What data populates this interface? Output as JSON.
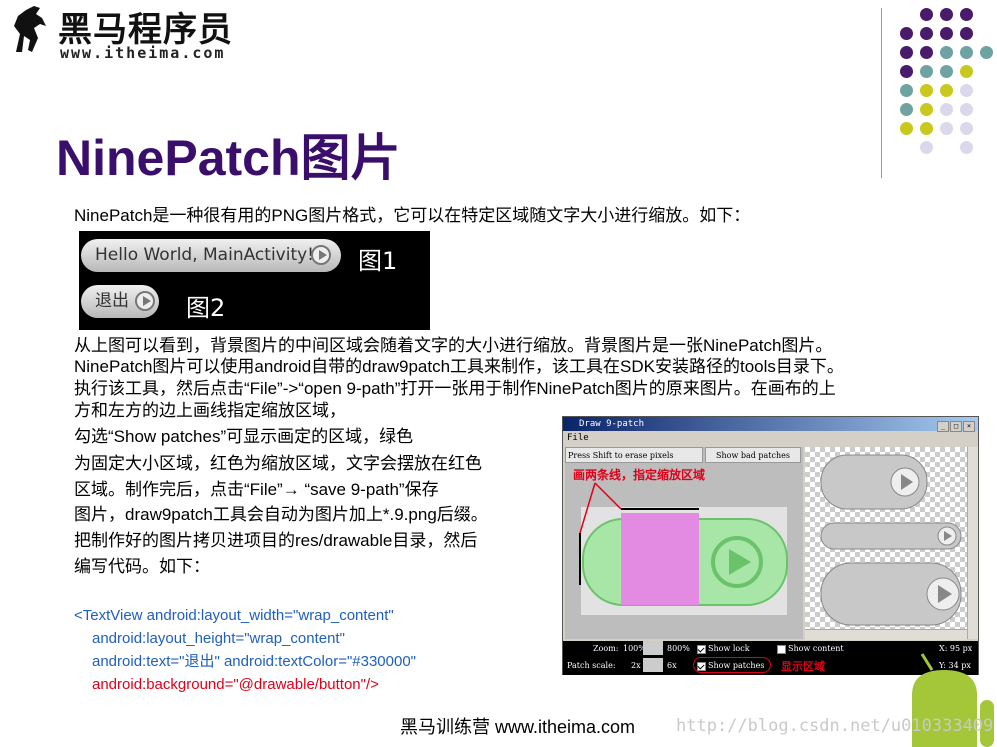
{
  "logo": {
    "brand": "黑马程序员",
    "url": "www.itheima.com"
  },
  "title": "NinePatch图片",
  "intro": "NinePatch是一种很有用的PNG图片格式，它可以在特定区域随文字大小进行缩放。如下：",
  "demo": {
    "button1": "Hello World, MainActivity!",
    "fig1": "图1",
    "button2": "退出",
    "fig2": "图2"
  },
  "paragraph": [
    "从上图可以看到，背景图片的中间区域会随着文字的大小进行缩放。背景图片是一张NinePatch图片。",
    "NinePatch图片可以使用android自带的draw9patch工具来制作，该工具在SDK安装路径的tools目录下。",
    "执行该工具，然后点击“File”->“open 9-path”打开一张用于制作NinePatch图片的原来图片。在画布的上",
    "方和左方的边上画线指定缩放区域，",
    "勾选“Show patches”可显示画定的区域，绿色",
    "为固定大小区域，红色为缩放区域，文字会摆放在红色",
    "区域。制作完后，点击“File”→ “save 9-path”保存",
    "图片，draw9patch工具会自动为图片加上*.9.png后缀。",
    "把制作好的图片拷贝进项目的res/drawable目录，然后",
    "编写代码。如下："
  ],
  "code": [
    "<TextView android:layout_width=\"wrap_content\"",
    "android:layout_height=\"wrap_content\"",
    "android:text=\"退出\" android:textColor=\"#330000\"",
    "android:background=\"@drawable/button\"/>"
  ],
  "window": {
    "title": "Draw 9-patch",
    "menu": "File",
    "hint": "Press Shift to erase pixels",
    "bad_patches": "Show bad patches",
    "annotation_top": "画两条线，指定缩放区域",
    "annotation_bottom": "显示区域",
    "zoom_label": "Zoom:",
    "zoom_min": "100%",
    "zoom_max": "800%",
    "scale_label": "Patch scale:",
    "scale_min": "2x",
    "scale_max": "6x",
    "show_lock": "Show lock",
    "show_patches": "Show patches",
    "show_content": "Show content",
    "x": "X: 95 px",
    "y": "Y: 34 px"
  },
  "footer": "黑马训练营 www.itheima.com",
  "watermark": "http://blog.csdn.net/u010333409",
  "colors": {
    "title": "#3a0f6b",
    "code_blue": "#1f5fbf",
    "code_red": "#e0001a",
    "dot_purple": "#4a1a6b",
    "dot_teal": "#6ea3a1",
    "dot_lime": "#c8c81e",
    "dot_lavender": "#dcd8ec"
  }
}
